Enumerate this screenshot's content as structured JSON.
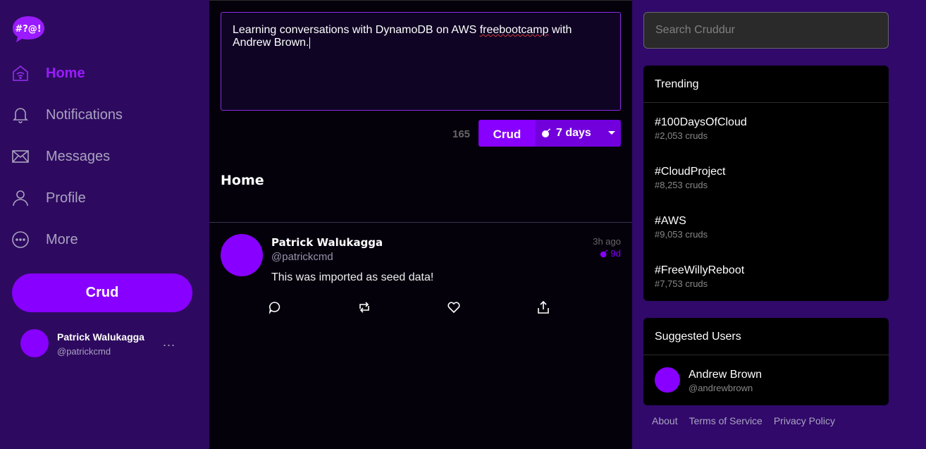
{
  "brand": {
    "logo_text": "#?@!",
    "accent": "#8800ff"
  },
  "nav": {
    "items": [
      {
        "label": "Home",
        "icon": "home-icon",
        "active": true
      },
      {
        "label": "Notifications",
        "icon": "bell-icon"
      },
      {
        "label": "Messages",
        "icon": "envelope-icon"
      },
      {
        "label": "Profile",
        "icon": "user-icon"
      },
      {
        "label": "More",
        "icon": "more-circle-icon"
      }
    ],
    "crud_label": "Crud"
  },
  "profile": {
    "name": "Patrick Walukagga",
    "handle": "@patrickcmd",
    "menu_glyph": "..."
  },
  "composer": {
    "text_before": "Learning conversations with DynamoDB on AWS ",
    "text_spell": "freebootcamp",
    "text_after": " with Andrew Brown.",
    "char_count": "165",
    "submit_label": "Crud",
    "expiry_label": "7 days"
  },
  "feed": {
    "title": "Home",
    "activities": [
      {
        "name": "Patrick Walukagga",
        "handle": "@patrickcmd",
        "time_ago": "3h ago",
        "expires": "9d",
        "message": "This was imported as seed data!"
      }
    ]
  },
  "search": {
    "placeholder": "Search Cruddur"
  },
  "trending": {
    "title": "Trending",
    "items": [
      {
        "tag": "#100DaysOfCloud",
        "count": "#2,053 cruds"
      },
      {
        "tag": "#CloudProject",
        "count": "#8,253 cruds"
      },
      {
        "tag": "#AWS",
        "count": "#9,053 cruds"
      },
      {
        "tag": "#FreeWillyReboot",
        "count": "#7,753 cruds"
      }
    ]
  },
  "suggested": {
    "title": "Suggested Users",
    "users": [
      {
        "name": "Andrew Brown",
        "handle": "@andrewbrown"
      }
    ]
  },
  "footer": {
    "links": [
      "About",
      "Terms of Service",
      "Privacy Policy"
    ]
  }
}
